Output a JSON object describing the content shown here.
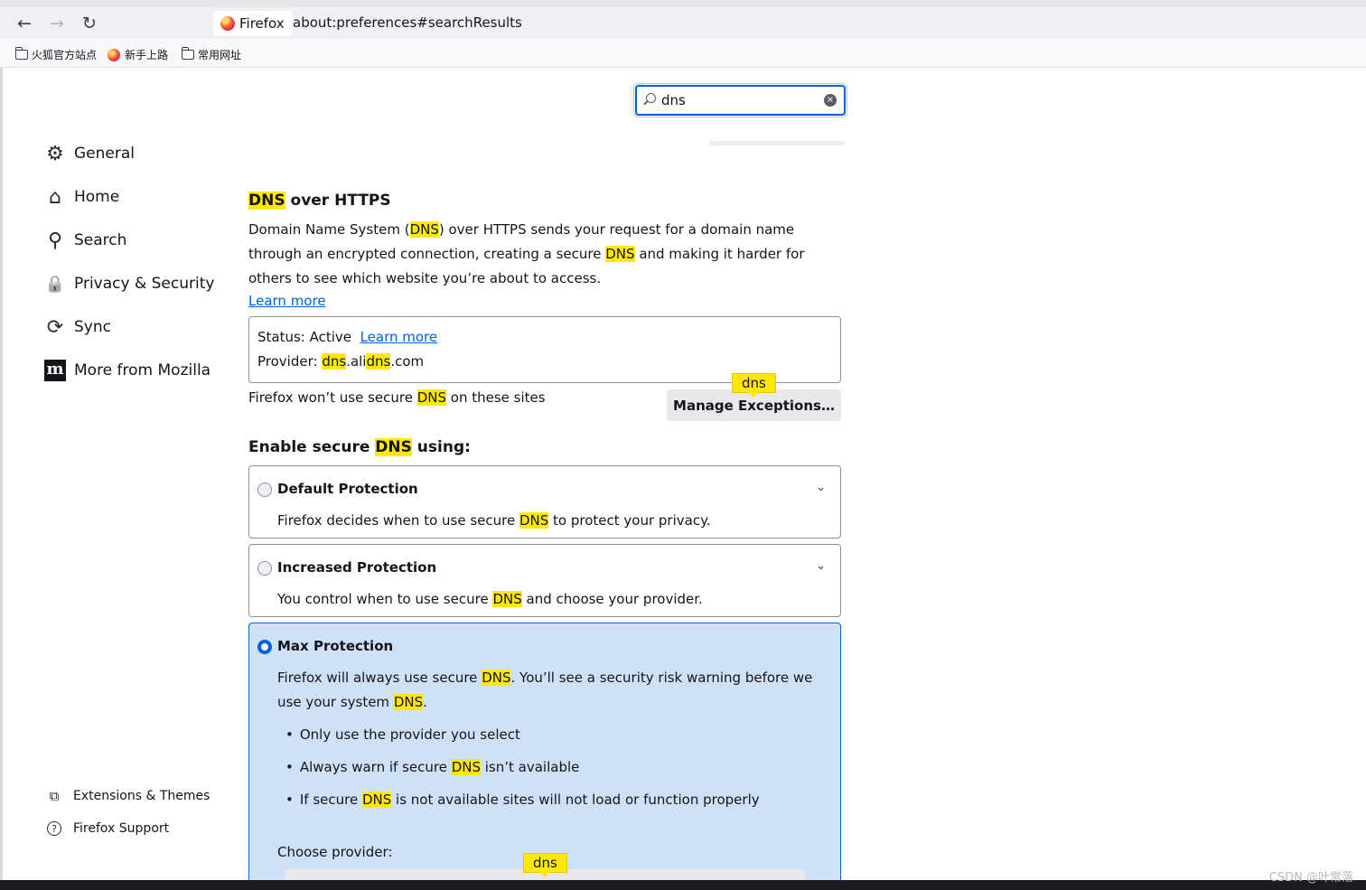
{
  "browser": {
    "back_glyph": "←",
    "forward_glyph": "→",
    "reload_glyph": "↻",
    "identity_label": "Firefox",
    "url": "about:preferences#searchResults"
  },
  "bookmarks": [
    {
      "label": "火狐官方站点",
      "icon": "folder-icon"
    },
    {
      "label": "新手上路",
      "icon": "firefox-globe-icon"
    },
    {
      "label": "常用网址",
      "icon": "folder-icon"
    }
  ],
  "search": {
    "value": "dns",
    "clear_glyph": "×"
  },
  "sidebar": {
    "items": [
      {
        "label": "General",
        "icon": "gear-icon",
        "glyph": "⚙"
      },
      {
        "label": "Home",
        "icon": "home-icon",
        "glyph": "⌂"
      },
      {
        "label": "Search",
        "icon": "search-icon",
        "glyph": "⚲"
      },
      {
        "label": "Privacy & Security",
        "icon": "lock-icon",
        "glyph": "🔒"
      },
      {
        "label": "Sync",
        "icon": "sync-icon",
        "glyph": "⟳"
      },
      {
        "label": "More from Mozilla",
        "icon": "mozilla-m-icon",
        "glyph": "m"
      }
    ],
    "footer": [
      {
        "label": "Extensions & Themes",
        "icon": "puzzle-icon",
        "glyph": "⧉"
      },
      {
        "label": "Firefox Support",
        "icon": "help-icon",
        "glyph": "?"
      }
    ]
  },
  "doh": {
    "title_hl": "DNS",
    "title_rest": " over HTTPS",
    "desc": {
      "p1": "Domain Name System (",
      "h1": "DNS",
      "p2": ") over HTTPS sends your request for a domain name through an encrypted connection, creating a secure ",
      "h2": "DNS",
      "p3": " and making it harder for others to see which website you’re about to access."
    },
    "learn_more": "Learn more",
    "status": {
      "label": "Status: Active",
      "learn_more": "Learn more",
      "provider_label": "Provider: ",
      "provider_h1": "dns",
      "provider_mid": ".ali",
      "provider_h2": "dns",
      "provider_end": ".com"
    },
    "exceptions": {
      "text_a": "Firefox won’t use secure ",
      "text_hl": "DNS",
      "text_b": " on these sites",
      "button": "Manage Exceptions…",
      "tooltip": "dns"
    },
    "enable": {
      "title_a": "Enable secure ",
      "title_hl": "DNS",
      "title_b": " using:"
    },
    "options": [
      {
        "title": "Default Protection",
        "sub_a": "Firefox decides when to use secure ",
        "sub_hl": "DNS",
        "sub_b": " to protect your privacy.",
        "chevron": "⌄",
        "selected": false
      },
      {
        "title": "Increased Protection",
        "sub_a": "You control when to use secure ",
        "sub_hl": "DNS",
        "sub_b": " and choose your provider.",
        "chevron": "⌄",
        "selected": false
      },
      {
        "title": "Max Protection",
        "sub_a": "Firefox will always use secure ",
        "sub_hl": "DNS",
        "sub_b": ". You’ll see a security risk warning before we use your system ",
        "sub_hl2": "DNS",
        "sub_c": ".",
        "selected": true,
        "bullets": [
          {
            "a": "Only use the provider you select",
            "hl": "",
            "b": ""
          },
          {
            "a": "Always warn if secure ",
            "hl": "DNS",
            "b": " isn’t available"
          },
          {
            "a": "If secure ",
            "hl": "DNS",
            "b": " is not available sites will not load or function properly"
          }
        ],
        "choose_provider": "Choose provider:",
        "provider_tooltip": "dns"
      }
    ]
  },
  "watermark": "CSDN @叶常落",
  "colors": {
    "accent": "#0061e0",
    "highlight": "#ffe900",
    "selected_bg": "#cfe1f7"
  }
}
